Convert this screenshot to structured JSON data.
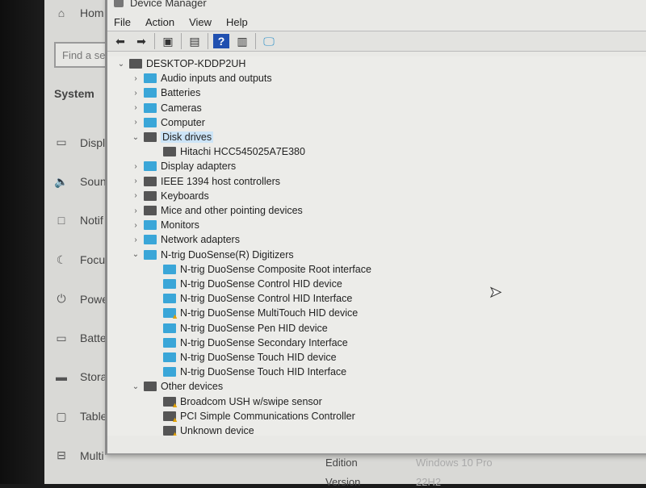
{
  "settings": {
    "home": "Hom",
    "search_placeholder": "Find a se",
    "section": "System",
    "items": [
      {
        "label": "Displ",
        "icon": "monitor-icon"
      },
      {
        "label": "Soun",
        "icon": "speaker-icon"
      },
      {
        "label": "Notif",
        "icon": "notification-icon"
      },
      {
        "label": "Focu",
        "icon": "moon-icon"
      },
      {
        "label": "Powe",
        "icon": "power-icon"
      },
      {
        "label": "Batte",
        "icon": "battery-icon"
      },
      {
        "label": "Stora",
        "icon": "storage-icon"
      },
      {
        "label": "Table",
        "icon": "tablet-icon"
      },
      {
        "label": "Multi",
        "icon": "multitasking-icon"
      }
    ],
    "about": {
      "edition_label": "Edition",
      "edition_value": "Windows 10 Pro",
      "version_label": "Version",
      "version_value": "22H2"
    }
  },
  "window": {
    "title": "Device Manager",
    "menu": [
      "File",
      "Action",
      "View",
      "Help"
    ],
    "toolbar": [
      "back-icon",
      "forward-icon",
      "properties-icon",
      "update-driver-icon",
      "help-icon",
      "view-icon",
      "scan-hardware-icon"
    ]
  },
  "tree": [
    {
      "label": "DESKTOP-KDDP2UH",
      "level": 0,
      "state": "expanded",
      "icon": "computer-icon"
    },
    {
      "label": "Audio inputs and outputs",
      "level": 1,
      "state": "collapsed",
      "icon": "speaker-icon"
    },
    {
      "label": "Batteries",
      "level": 1,
      "state": "collapsed",
      "icon": "battery-icon"
    },
    {
      "label": "Cameras",
      "level": 1,
      "state": "collapsed",
      "icon": "camera-icon"
    },
    {
      "label": "Computer",
      "level": 1,
      "state": "collapsed",
      "icon": "monitor-icon"
    },
    {
      "label": "Disk drives",
      "level": 1,
      "state": "expanded",
      "icon": "disk-icon",
      "selected": true
    },
    {
      "label": "Hitachi HCC545025A7E380",
      "level": 2,
      "icon": "disk-icon"
    },
    {
      "label": "Display adapters",
      "level": 1,
      "state": "collapsed",
      "icon": "display-adapter-icon"
    },
    {
      "label": "IEEE 1394 host controllers",
      "level": 1,
      "state": "collapsed",
      "icon": "plug-icon"
    },
    {
      "label": "Keyboards",
      "level": 1,
      "state": "collapsed",
      "icon": "keyboard-icon"
    },
    {
      "label": "Mice and other pointing devices",
      "level": 1,
      "state": "collapsed",
      "icon": "mouse-icon"
    },
    {
      "label": "Monitors",
      "level": 1,
      "state": "collapsed",
      "icon": "monitor-icon"
    },
    {
      "label": "Network adapters",
      "level": 1,
      "state": "collapsed",
      "icon": "network-icon"
    },
    {
      "label": "N-trig DuoSense(R) Digitizers",
      "level": 1,
      "state": "expanded",
      "icon": "hid-icon"
    },
    {
      "label": "N-trig DuoSense Composite Root interface",
      "level": 2,
      "icon": "hid-icon"
    },
    {
      "label": "N-trig DuoSense Control HID device",
      "level": 2,
      "icon": "hid-icon"
    },
    {
      "label": "N-trig DuoSense Control HID Interface",
      "level": 2,
      "icon": "hid-icon"
    },
    {
      "label": "N-trig DuoSense MultiTouch HID device",
      "level": 2,
      "icon": "hid-warning-icon",
      "warning": true
    },
    {
      "label": "N-trig DuoSense Pen HID device",
      "level": 2,
      "icon": "hid-icon"
    },
    {
      "label": "N-trig DuoSense Secondary Interface",
      "level": 2,
      "icon": "hid-icon"
    },
    {
      "label": "N-trig DuoSense Touch HID device",
      "level": 2,
      "icon": "hid-icon"
    },
    {
      "label": "N-trig DuoSense Touch HID Interface",
      "level": 2,
      "icon": "hid-icon"
    },
    {
      "label": "Other devices",
      "level": 1,
      "state": "expanded",
      "icon": "unknown-device-icon"
    },
    {
      "label": "Broadcom USH w/swipe sensor",
      "level": 2,
      "icon": "unknown-device-warning-icon",
      "warning": true
    },
    {
      "label": "PCI Simple Communications Controller",
      "level": 2,
      "icon": "unknown-device-warning-icon",
      "warning": true
    },
    {
      "label": "Unknown device",
      "level": 2,
      "icon": "unknown-device-warning-icon",
      "warning": true
    }
  ],
  "colors": {
    "selection": "#cce4f7",
    "device_icon": "#3aa6d8",
    "warning": "#e0a000"
  }
}
